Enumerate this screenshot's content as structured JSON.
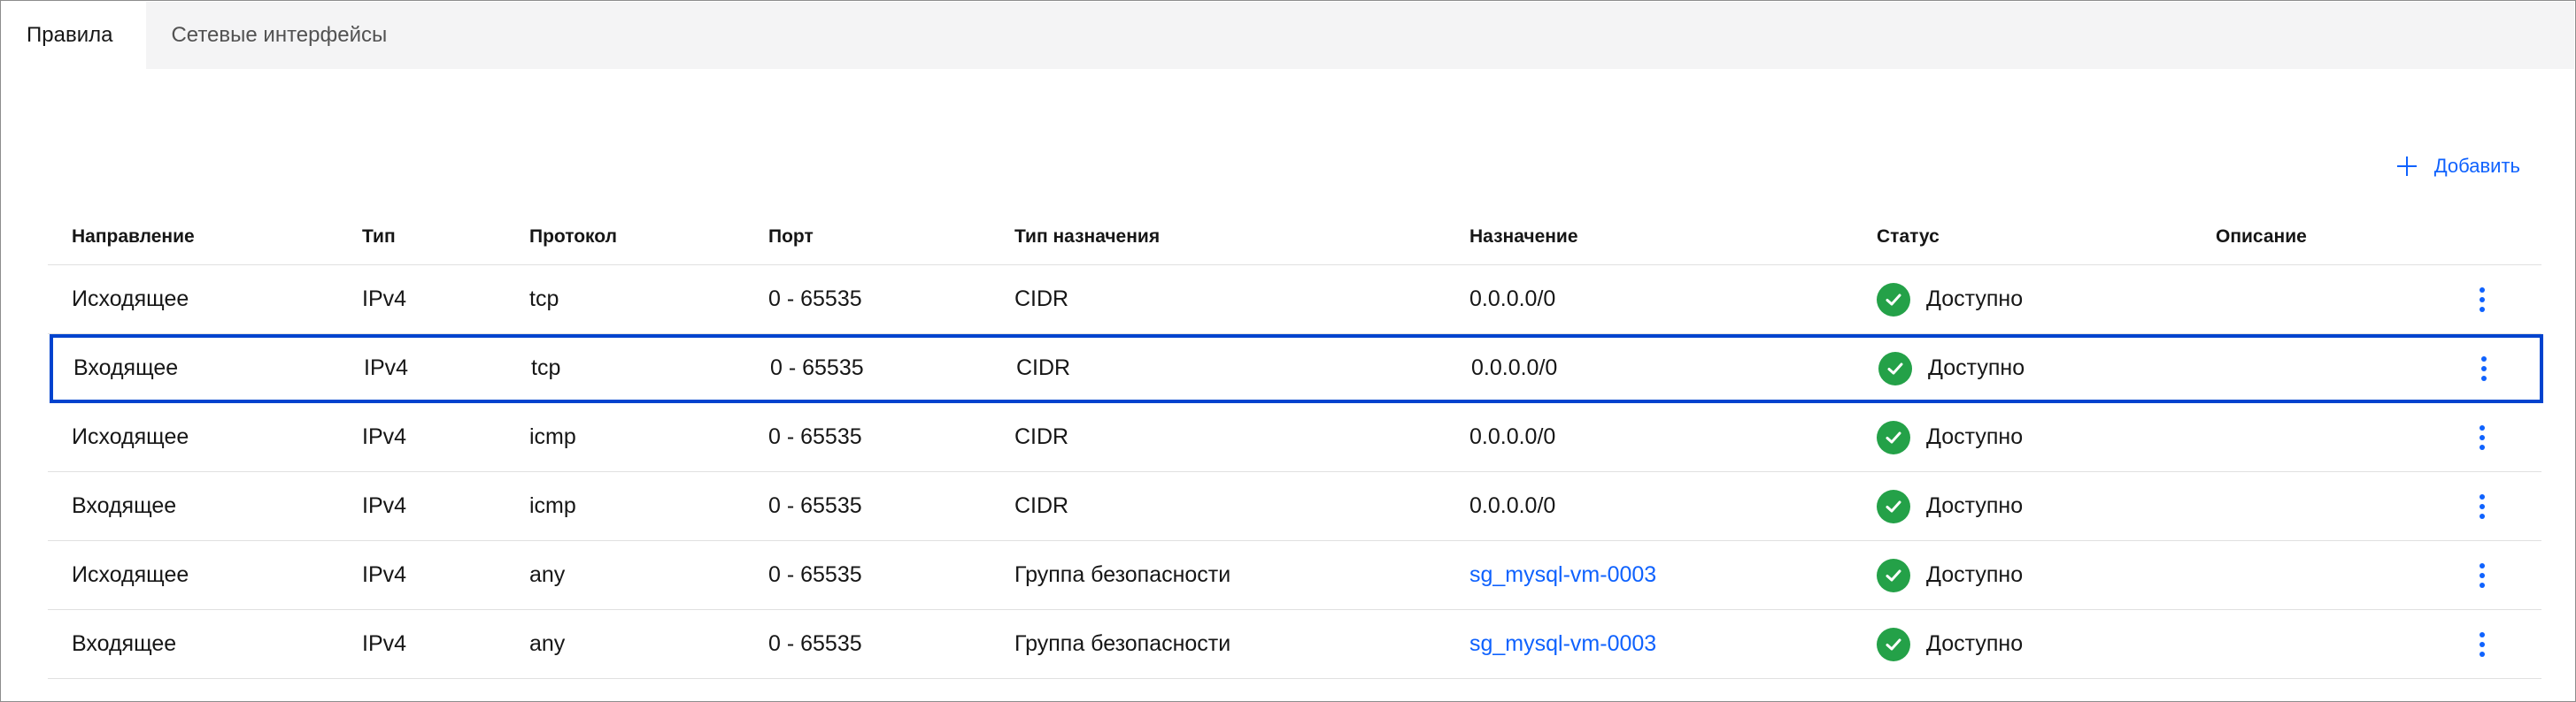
{
  "tabs": [
    {
      "label": "Правила",
      "active": true
    },
    {
      "label": "Сетевые интерфейсы",
      "active": false
    }
  ],
  "add_label": "Добавить",
  "columns": [
    "Направление",
    "Тип",
    "Протокол",
    "Порт",
    "Тип назначения",
    "Назначение",
    "Статус",
    "Описание"
  ],
  "rows": [
    {
      "direction": "Исходящее",
      "type": "IPv4",
      "protocol": "tcp",
      "port": "0 - 65535",
      "dest_type": "CIDR",
      "destination": "0.0.0.0/0",
      "dest_is_link": false,
      "status": "Доступно",
      "description": ""
    },
    {
      "direction": "Входящее",
      "type": "IPv4",
      "protocol": "tcp",
      "port": "0 - 65535",
      "dest_type": "CIDR",
      "destination": "0.0.0.0/0",
      "dest_is_link": false,
      "status": "Доступно",
      "description": "",
      "selected": true
    },
    {
      "direction": "Исходящее",
      "type": "IPv4",
      "protocol": "icmp",
      "port": "0 - 65535",
      "dest_type": "CIDR",
      "destination": "0.0.0.0/0",
      "dest_is_link": false,
      "status": "Доступно",
      "description": ""
    },
    {
      "direction": "Входящее",
      "type": "IPv4",
      "protocol": "icmp",
      "port": "0 - 65535",
      "dest_type": "CIDR",
      "destination": "0.0.0.0/0",
      "dest_is_link": false,
      "status": "Доступно",
      "description": ""
    },
    {
      "direction": "Исходящее",
      "type": "IPv4",
      "protocol": "any",
      "port": "0 - 65535",
      "dest_type": "Группа безопасности",
      "destination": "sg_mysql-vm-0003",
      "dest_is_link": true,
      "status": "Доступно",
      "description": ""
    },
    {
      "direction": "Входящее",
      "type": "IPv4",
      "protocol": "any",
      "port": "0 - 65535",
      "dest_type": "Группа безопасности",
      "destination": "sg_mysql-vm-0003",
      "dest_is_link": true,
      "status": "Доступно",
      "description": ""
    }
  ],
  "colors": {
    "accent": "#0f62fe",
    "success": "#24a148",
    "selection": "#0043ce"
  },
  "icons": {
    "add": "plus-icon",
    "status": "checkmark-filled-icon",
    "row_menu": "overflow-menu-vertical-icon"
  }
}
